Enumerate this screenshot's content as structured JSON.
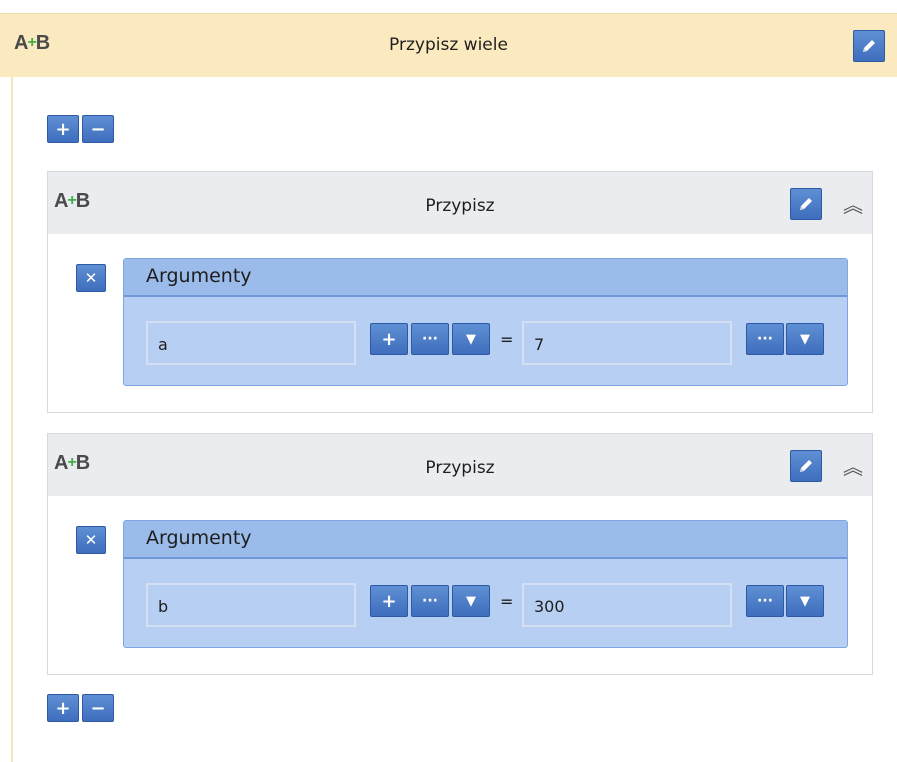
{
  "outer": {
    "title": "Przypisz wiele",
    "icon": "assign-icon",
    "edit_icon": "pencil-icon"
  },
  "controls": {
    "add_icon": "plus-icon",
    "remove_icon": "minus-icon",
    "plus_glyph": "+",
    "minus_glyph": "−"
  },
  "assignments": [
    {
      "title": "Przypisz",
      "args_label": "Argumenty",
      "variable": "a",
      "value": "7",
      "equals": "="
    },
    {
      "title": "Przypisz",
      "args_label": "Argumenty",
      "variable": "b",
      "value": "300",
      "equals": "="
    }
  ],
  "colors": {
    "outer_header": "#fbeabf",
    "button_blue": "#4a7cc8",
    "args_panel": "#b7cff2",
    "card_header": "#eaecef",
    "icon_green": "#3fae49"
  }
}
